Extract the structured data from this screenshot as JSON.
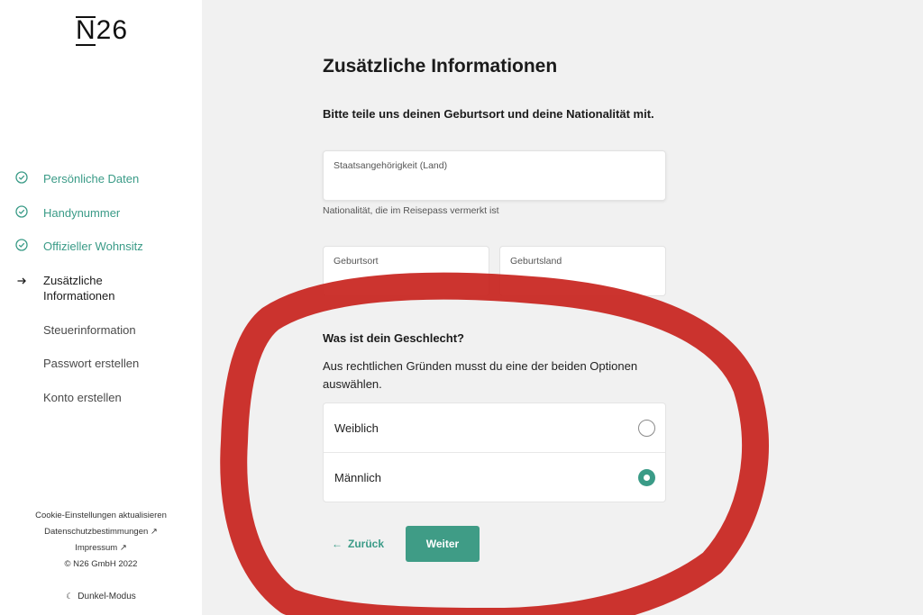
{
  "brand": {
    "logo_n": "N",
    "logo_rest": "26"
  },
  "sidebar": {
    "steps": [
      {
        "label": "Persönliche Daten",
        "status": "done"
      },
      {
        "label": "Handynummer",
        "status": "done"
      },
      {
        "label": "Offizieller Wohnsitz",
        "status": "done"
      },
      {
        "label": "Zusätzliche Informationen",
        "status": "current"
      },
      {
        "label": "Steuerinformation",
        "status": "todo"
      },
      {
        "label": "Passwort erstellen",
        "status": "todo"
      },
      {
        "label": "Konto erstellen",
        "status": "todo"
      }
    ],
    "footer": {
      "cookie": "Cookie-Einstellungen aktualisieren",
      "privacy": "Datenschutzbestimmungen ↗",
      "imprint": "Impressum ↗",
      "copyright": "© N26 GmbH 2022",
      "dark_mode": "Dunkel-Modus"
    }
  },
  "main": {
    "title": "Zusätzliche Informationen",
    "birth_question": "Bitte teile uns deinen Geburtsort und deine Nationalität mit.",
    "nationality_placeholder": "Staatsangehörigkeit (Land)",
    "nationality_hint": "Nationalität, die im Reisepass vermerkt ist",
    "birthplace_placeholder": "Geburtsort",
    "birthcountry_placeholder": "Geburtsland",
    "gender_question": "Was ist dein Geschlecht?",
    "gender_desc": "Aus rechtlichen Gründen musst du eine der beiden Optionen auswählen.",
    "options": [
      {
        "label": "Weiblich",
        "selected": false
      },
      {
        "label": "Männlich",
        "selected": true
      }
    ],
    "back_label": "Zurück",
    "next_label": "Weiter"
  },
  "colors": {
    "accent": "#3a9b87",
    "annotation": "#c8231d"
  }
}
